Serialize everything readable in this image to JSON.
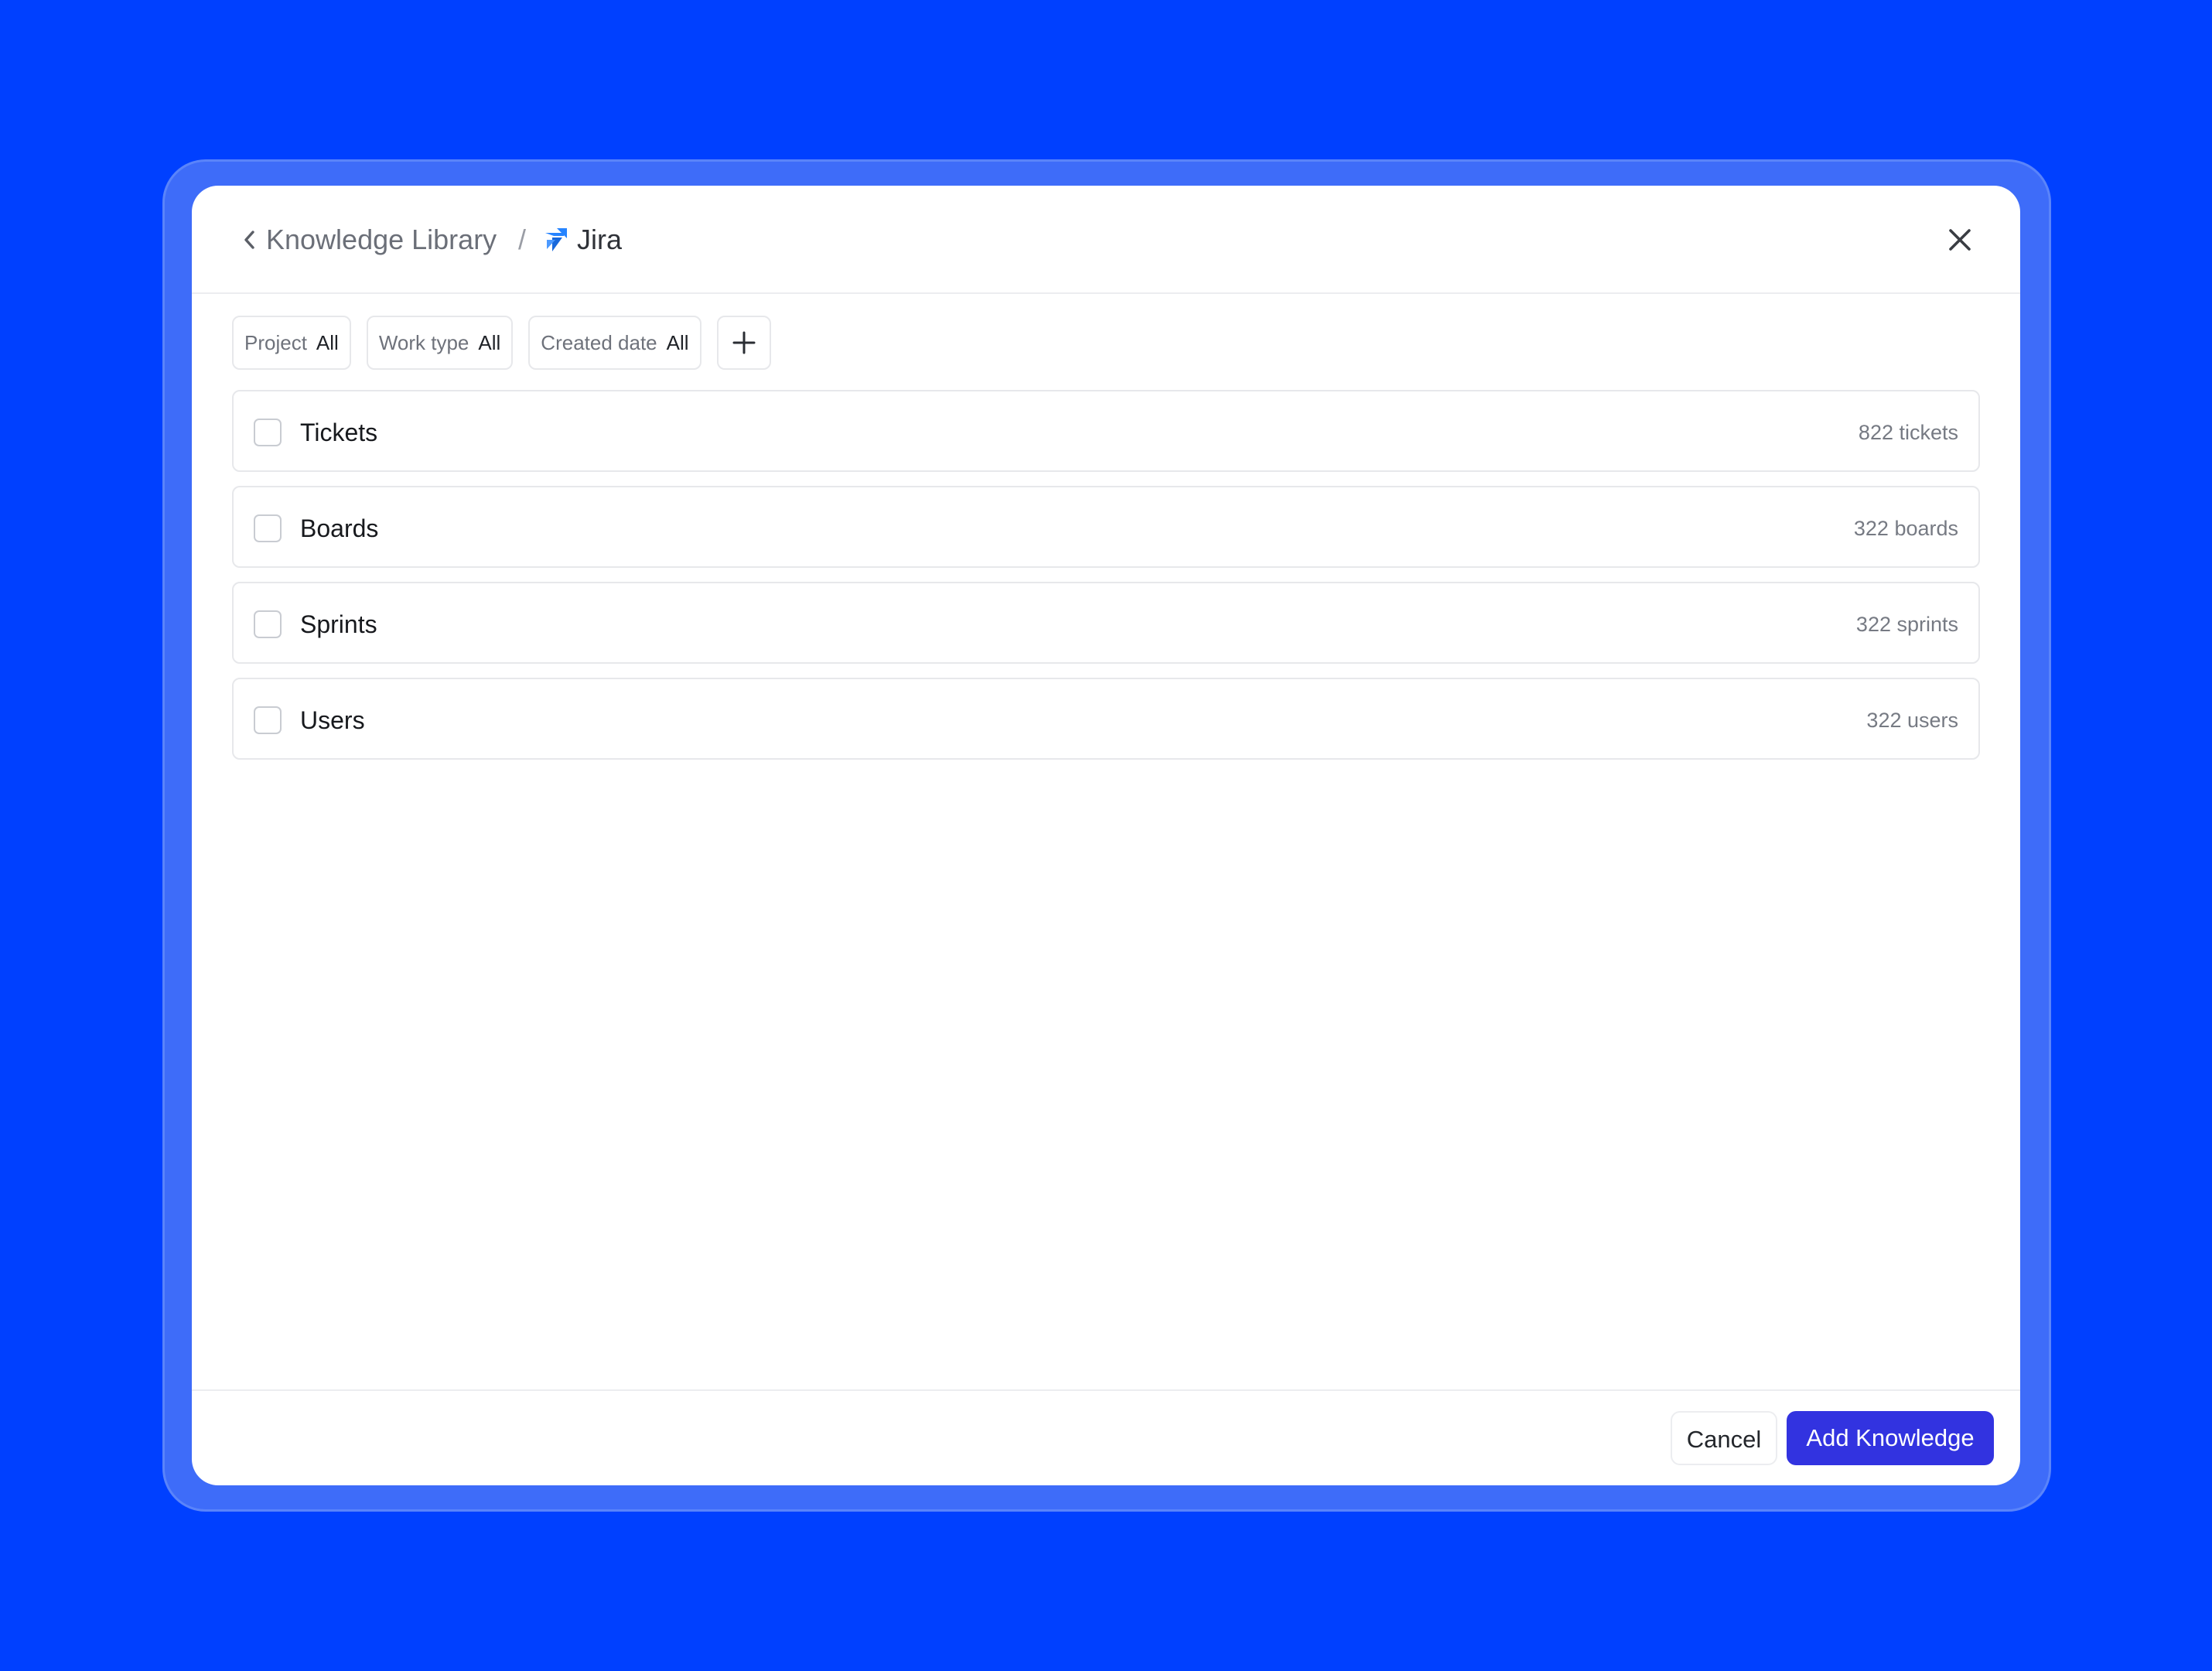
{
  "header": {
    "library_label": "Knowledge Library",
    "separator": "/",
    "current_label": "Jira"
  },
  "filters": [
    {
      "label": "Project",
      "value": "All"
    },
    {
      "label": "Work type",
      "value": "All"
    },
    {
      "label": "Created date",
      "value": "All"
    }
  ],
  "items": [
    {
      "label": "Tickets",
      "count": "822 tickets",
      "checked": false
    },
    {
      "label": "Boards",
      "count": "322 boards",
      "checked": false
    },
    {
      "label": "Sprints",
      "count": "322 sprints",
      "checked": false
    },
    {
      "label": "Users",
      "count": "322 users",
      "checked": false
    }
  ],
  "footer": {
    "cancel_label": "Cancel",
    "submit_label": "Add Knowledge"
  },
  "icons": {
    "back": "chevron-left-icon",
    "source": "jira-logo-icon",
    "close": "close-icon",
    "add_filter": "plus-icon"
  },
  "colors": {
    "background": "#0040FF",
    "primary_button": "#3233E0",
    "jira_blue": "#2684FF"
  }
}
